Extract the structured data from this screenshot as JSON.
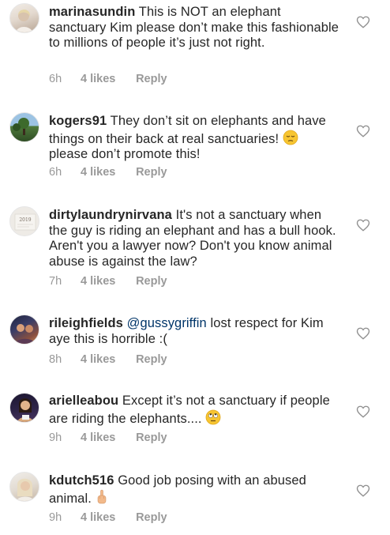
{
  "comments": [
    {
      "username": "marinasundin",
      "text": "This is NOT an elephant sanctuary Kim please don’t make this fashionable to millions of people it’s just not right.",
      "time": "6h",
      "likes": "4 likes",
      "reply": "Reply",
      "avatar_colors": [
        "#e8e2dc",
        "#b9a898"
      ]
    },
    {
      "username": "kogers91",
      "text": "They don’t sit on elephants and have things on their back at real sanctuaries!",
      "emoji": "pensive-face-emoji",
      "text_after": "please don’t promote this!",
      "time": "6h",
      "likes": "4 likes",
      "reply": "Reply",
      "avatar_colors": [
        "#8fb7d9",
        "#3d5e2f"
      ]
    },
    {
      "username": "dirtylaundrynirvana",
      "text": "It's not a sanctuary when the guy is riding an elephant and has a bull hook.  Aren't you a lawyer now?  Don't you know animal abuse is against the law?",
      "avatar_text": "2019",
      "time": "7h",
      "likes": "4 likes",
      "reply": "Reply",
      "avatar_colors": [
        "#ece9e4",
        "#7a6f64"
      ]
    },
    {
      "username": "rileighfields",
      "mention": "@gussygriffin",
      "text": "lost respect for Kim aye this is horrible :(",
      "time": "8h",
      "likes": "4 likes",
      "reply": "Reply",
      "avatar_colors": [
        "#2b2f4a",
        "#b06a5a"
      ]
    },
    {
      "username": "arielleabou",
      "text": "Except it’s not a sanctuary if people are riding the elephants....",
      "emoji": "eye-roll-face-emoji",
      "time": "9h",
      "likes": "4 likes",
      "reply": "Reply",
      "avatar_colors": [
        "#2a2140",
        "#d9b48a"
      ]
    },
    {
      "username": "kdutch516",
      "text": "Good job posing with an abused animal.",
      "emoji": "middle-finger-emoji",
      "time": "9h",
      "likes": "4 likes",
      "reply": "Reply",
      "avatar_colors": [
        "#e7e3de",
        "#c9b7a4"
      ]
    }
  ],
  "colors": {
    "username": "#262626",
    "text": "#262626",
    "meta": "#999999",
    "mention": "#003569",
    "heart": "#8e8e8e"
  }
}
